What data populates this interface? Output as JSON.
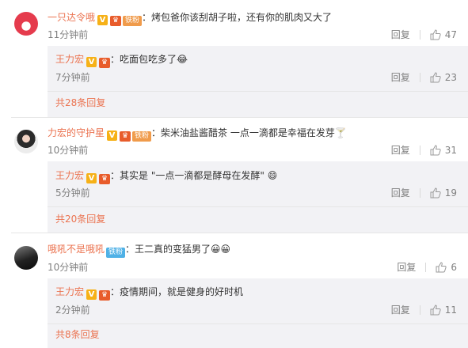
{
  "comments": [
    {
      "user": "一只达令哦",
      "fan_badge": "铁粉",
      "text": "烤包爸你该刮胡子啦，还有你的肌肉又大了",
      "time": "11分钟前",
      "reply_label": "回复",
      "likes": "47",
      "reply": {
        "user": "王力宏",
        "text": "吃面包吃多了😂",
        "time": "7分钟前",
        "reply_label": "回复",
        "likes": "23"
      },
      "more_replies": "共28条回复"
    },
    {
      "user": "力宏的守护星",
      "fan_badge": "铁粉",
      "text": "柴米油盐酱醋茶 一点一滴都是幸福在发芽🍸",
      "time": "10分钟前",
      "reply_label": "回复",
      "likes": "31",
      "reply": {
        "user": "王力宏",
        "text": "其实是 \"一点一滴都是酵母在发酵\" 😄",
        "time": "5分钟前",
        "reply_label": "回复",
        "likes": "19"
      },
      "more_replies": "共20条回复"
    },
    {
      "user": "哦吼不是哦吼",
      "fan_badge": "铁粉",
      "text": "王二真的变猛男了😀😀",
      "time": "10分钟前",
      "reply_label": "回复",
      "likes": "6",
      "reply": {
        "user": "王力宏",
        "text": "疫情期间，就是健身的好时机",
        "time": "2分钟前",
        "reply_label": "回复",
        "likes": "11"
      },
      "more_replies": "共8条回复"
    }
  ],
  "icons": {
    "verified": "verified-v-icon",
    "member": "vip-crown-icon",
    "like": "thumbs-up-icon"
  },
  "colors": {
    "username": "#eb7350",
    "verified_badge": "#f6b117",
    "fan_badge_orange": "#f09b4b",
    "fan_badge_blue": "#4fb1e6",
    "reply_background": "#f2f2f5"
  }
}
